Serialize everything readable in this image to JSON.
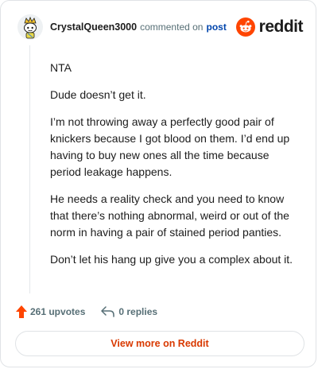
{
  "comment": {
    "username": "CrystalQueen3000",
    "meta_text": "commented on",
    "post_link": "post",
    "paragraphs": [
      "NTA",
      "Dude doesn’t get it.",
      "I’m not throwing away a perfectly good pair of knickers because I got blood on them. I’d end up having to buy new ones all the time because period leakage happens.",
      "He needs a reality check and you need to know that there’s nothing abnormal, weird or out of the norm in having a pair of stained period panties.",
      "Don’t let his hang up give you a complex about it."
    ]
  },
  "brand": {
    "name": "reddit",
    "color": "#ff4500"
  },
  "actions": {
    "upvotes_label": "261 upvotes",
    "replies_label": "0 replies",
    "upvote_color": "#ff4500"
  },
  "footer": {
    "view_more_label": "View more on Reddit",
    "accent": "#d93900"
  },
  "icons": {
    "avatar": "avatar-snoo-icon",
    "logo": "reddit-logo-icon",
    "upvote": "upvote-arrow-icon",
    "reply": "reply-arrow-icon"
  }
}
